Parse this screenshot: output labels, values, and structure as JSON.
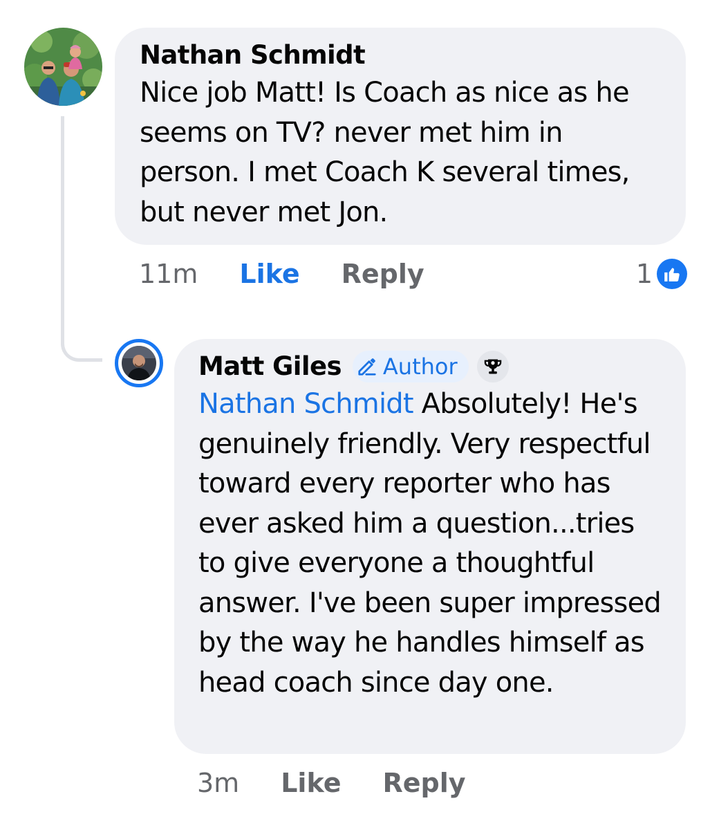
{
  "comment1": {
    "author": "Nathan Schmidt",
    "text": "Nice job Matt! Is Coach as nice as he seems on TV? never met him in person. I met Coach K several times, but never met Jon.",
    "time": "11m",
    "like_label": "Like",
    "reply_label": "Reply",
    "reaction_count": "1",
    "reaction_icon": "thumbs-up-icon"
  },
  "comment2": {
    "author": "Matt Giles",
    "badge_label": "Author",
    "badge_icon": "pencil-icon",
    "trophy_icon": "trophy-icon",
    "mention": "Nathan Schmidt",
    "text": "Absolutely! He's genuinely friendly. Very respectful toward every reporter who has ever asked him a question...tries to give everyone a thoughtful answer. I've been super impressed by the way he handles himself as head coach since day one.",
    "time": "3m",
    "like_label": "Like",
    "reply_label": "Reply"
  },
  "colors": {
    "bubble": "#f0f1f5",
    "link_blue": "#1b74e4",
    "meta_gray": "#65676b"
  }
}
